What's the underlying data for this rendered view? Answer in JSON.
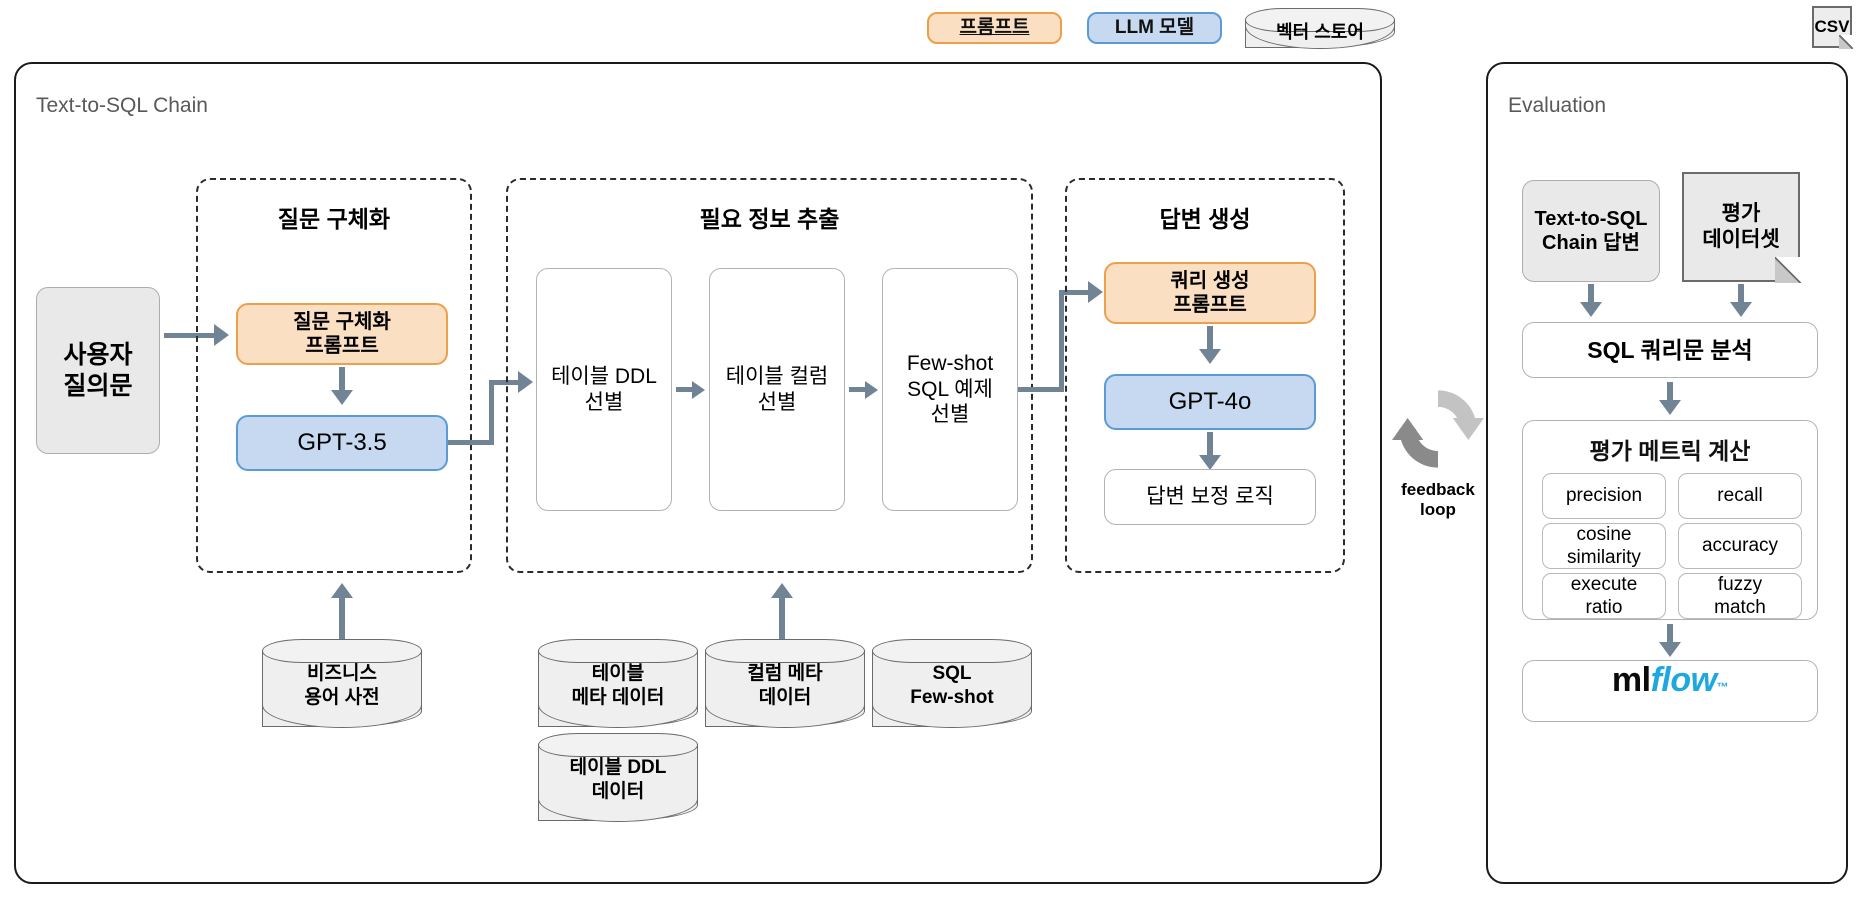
{
  "legend": {
    "prompt": "프롬프트",
    "llm": "LLM 모델",
    "vector_store": "벡터 스토어",
    "csv": "CSV"
  },
  "chain_panel": {
    "title": "Text-to-SQL Chain",
    "input_node": "사용자\n질의문",
    "groups": [
      {
        "title": "질문 구체화",
        "nodes": [
          {
            "label": "질문 구체화\n프롬프트",
            "type": "prompt"
          },
          {
            "label": "GPT-3.5",
            "type": "llm"
          }
        ]
      },
      {
        "title": "필요 정보 추출",
        "nodes": [
          {
            "label": "테이블 DDL\n선별",
            "type": "plain"
          },
          {
            "label": "테이블 컬럼\n선별",
            "type": "plain"
          },
          {
            "label": "Few-shot\nSQL 예제\n선별",
            "type": "plain"
          }
        ]
      },
      {
        "title": "답변 생성",
        "nodes": [
          {
            "label": "쿼리 생성\n프롬프트",
            "type": "prompt"
          },
          {
            "label": "GPT-4o",
            "type": "llm"
          },
          {
            "label": "답변 보정 로직",
            "type": "plain"
          }
        ]
      }
    ],
    "stores": [
      {
        "label": "비즈니스\n용어 사전"
      },
      {
        "label": "테이블\n메타 데이터"
      },
      {
        "label": "테이블 DDL\n데이터"
      },
      {
        "label": "컬럼 메타\n데이터"
      },
      {
        "label": "SQL\nFew-shot"
      }
    ]
  },
  "feedback": {
    "label_line1": "feedback",
    "label_line2": "loop"
  },
  "evaluation_panel": {
    "title": "Evaluation",
    "chain_answer": "Text-to-SQL\nChain 답변",
    "eval_dataset": "평가\n데이터셋",
    "sql_analysis": "SQL 쿼리문 분석",
    "metric_group_title": "평가 메트릭 계산",
    "metrics": [
      "precision",
      "recall",
      "cosine\nsimilarity",
      "accuracy",
      "execute\nratio",
      "fuzzy\nmatch"
    ],
    "tracking_tool": {
      "part1": "ml",
      "part2": "flow",
      "tm": "™"
    }
  },
  "colors": {
    "prompt_fill": "#fbdfc3",
    "prompt_border": "#eda04c",
    "llm_fill": "#c6d9f1",
    "llm_border": "#5b9bd5",
    "neutral_fill": "#e9e9e9",
    "arrow": "#718496",
    "container_border": "#1a1a1a",
    "mlflow_blue": "#1fa8e0"
  }
}
